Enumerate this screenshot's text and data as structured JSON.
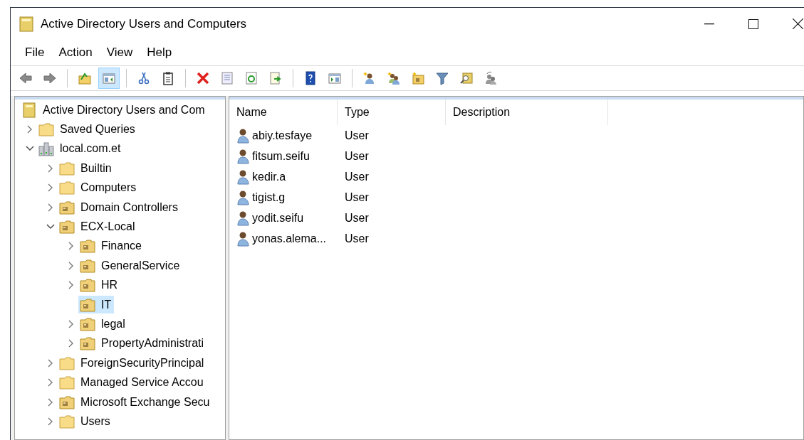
{
  "window": {
    "title": "Active Directory Users and Computers"
  },
  "menu": [
    "File",
    "Action",
    "View",
    "Help"
  ],
  "toolbar": [
    {
      "kind": "back",
      "pressed": false
    },
    {
      "kind": "forward",
      "pressed": false
    },
    {
      "kind": "sep"
    },
    {
      "kind": "up",
      "pressed": false
    },
    {
      "kind": "tree",
      "pressed": true
    },
    {
      "kind": "sep"
    },
    {
      "kind": "cut",
      "pressed": false
    },
    {
      "kind": "paste",
      "pressed": false
    },
    {
      "kind": "sep"
    },
    {
      "kind": "delete",
      "pressed": false
    },
    {
      "kind": "properties",
      "pressed": false
    },
    {
      "kind": "refresh",
      "pressed": false
    },
    {
      "kind": "export",
      "pressed": false
    },
    {
      "kind": "sep"
    },
    {
      "kind": "help",
      "pressed": false
    },
    {
      "kind": "action",
      "pressed": false
    },
    {
      "kind": "sep"
    },
    {
      "kind": "newuser",
      "pressed": false
    },
    {
      "kind": "newgroup",
      "pressed": false
    },
    {
      "kind": "newou",
      "pressed": false
    },
    {
      "kind": "filter",
      "pressed": false
    },
    {
      "kind": "find",
      "pressed": false
    },
    {
      "kind": "delegate",
      "pressed": false
    }
  ],
  "tree": {
    "label": "Active Directory Users and Com",
    "kind": "root",
    "selected": false,
    "children": [
      {
        "label": "Saved Queries",
        "kind": "folder",
        "expandable": true,
        "expanded": false,
        "selected": false
      },
      {
        "label": "local.com.et",
        "kind": "domain",
        "expandable": true,
        "expanded": true,
        "selected": false,
        "children": [
          {
            "label": "Builtin",
            "kind": "folder",
            "expandable": true,
            "expanded": false,
            "selected": false
          },
          {
            "label": "Computers",
            "kind": "folder",
            "expandable": true,
            "expanded": false,
            "selected": false
          },
          {
            "label": "Domain Controllers",
            "kind": "ou",
            "expandable": true,
            "expanded": false,
            "selected": false
          },
          {
            "label": "ECX-Local",
            "kind": "ou",
            "expandable": true,
            "expanded": true,
            "selected": false,
            "children": [
              {
                "label": "Finance",
                "kind": "ou",
                "expandable": true,
                "expanded": false,
                "selected": false
              },
              {
                "label": "GeneralService",
                "kind": "ou",
                "expandable": true,
                "expanded": false,
                "selected": false
              },
              {
                "label": "HR",
                "kind": "ou",
                "expandable": true,
                "expanded": false,
                "selected": false
              },
              {
                "label": "IT",
                "kind": "ou",
                "expandable": false,
                "expanded": false,
                "selected": true
              },
              {
                "label": "legal",
                "kind": "ou",
                "expandable": true,
                "expanded": false,
                "selected": false
              },
              {
                "label": "PropertyAdministrati",
                "kind": "ou",
                "expandable": true,
                "expanded": false,
                "selected": false
              }
            ]
          },
          {
            "label": "ForeignSecurityPrincipal",
            "kind": "folder",
            "expandable": true,
            "expanded": false,
            "selected": false
          },
          {
            "label": "Managed Service Accou",
            "kind": "folder",
            "expandable": true,
            "expanded": false,
            "selected": false
          },
          {
            "label": "Microsoft Exchange Secu",
            "kind": "ou",
            "expandable": true,
            "expanded": false,
            "selected": false
          },
          {
            "label": "Users",
            "kind": "folder",
            "expandable": true,
            "expanded": false,
            "selected": false
          }
        ]
      }
    ]
  },
  "list": {
    "columns": [
      "Name",
      "Type",
      "Description"
    ],
    "rows": [
      {
        "name": "abiy.tesfaye",
        "type": "User"
      },
      {
        "name": "fitsum.seifu",
        "type": "User"
      },
      {
        "name": "kedir.a",
        "type": "User"
      },
      {
        "name": "tigist.g",
        "type": "User"
      },
      {
        "name": "yodit.seifu",
        "type": "User"
      },
      {
        "name": "yonas.alema...",
        "type": "User"
      }
    ]
  }
}
